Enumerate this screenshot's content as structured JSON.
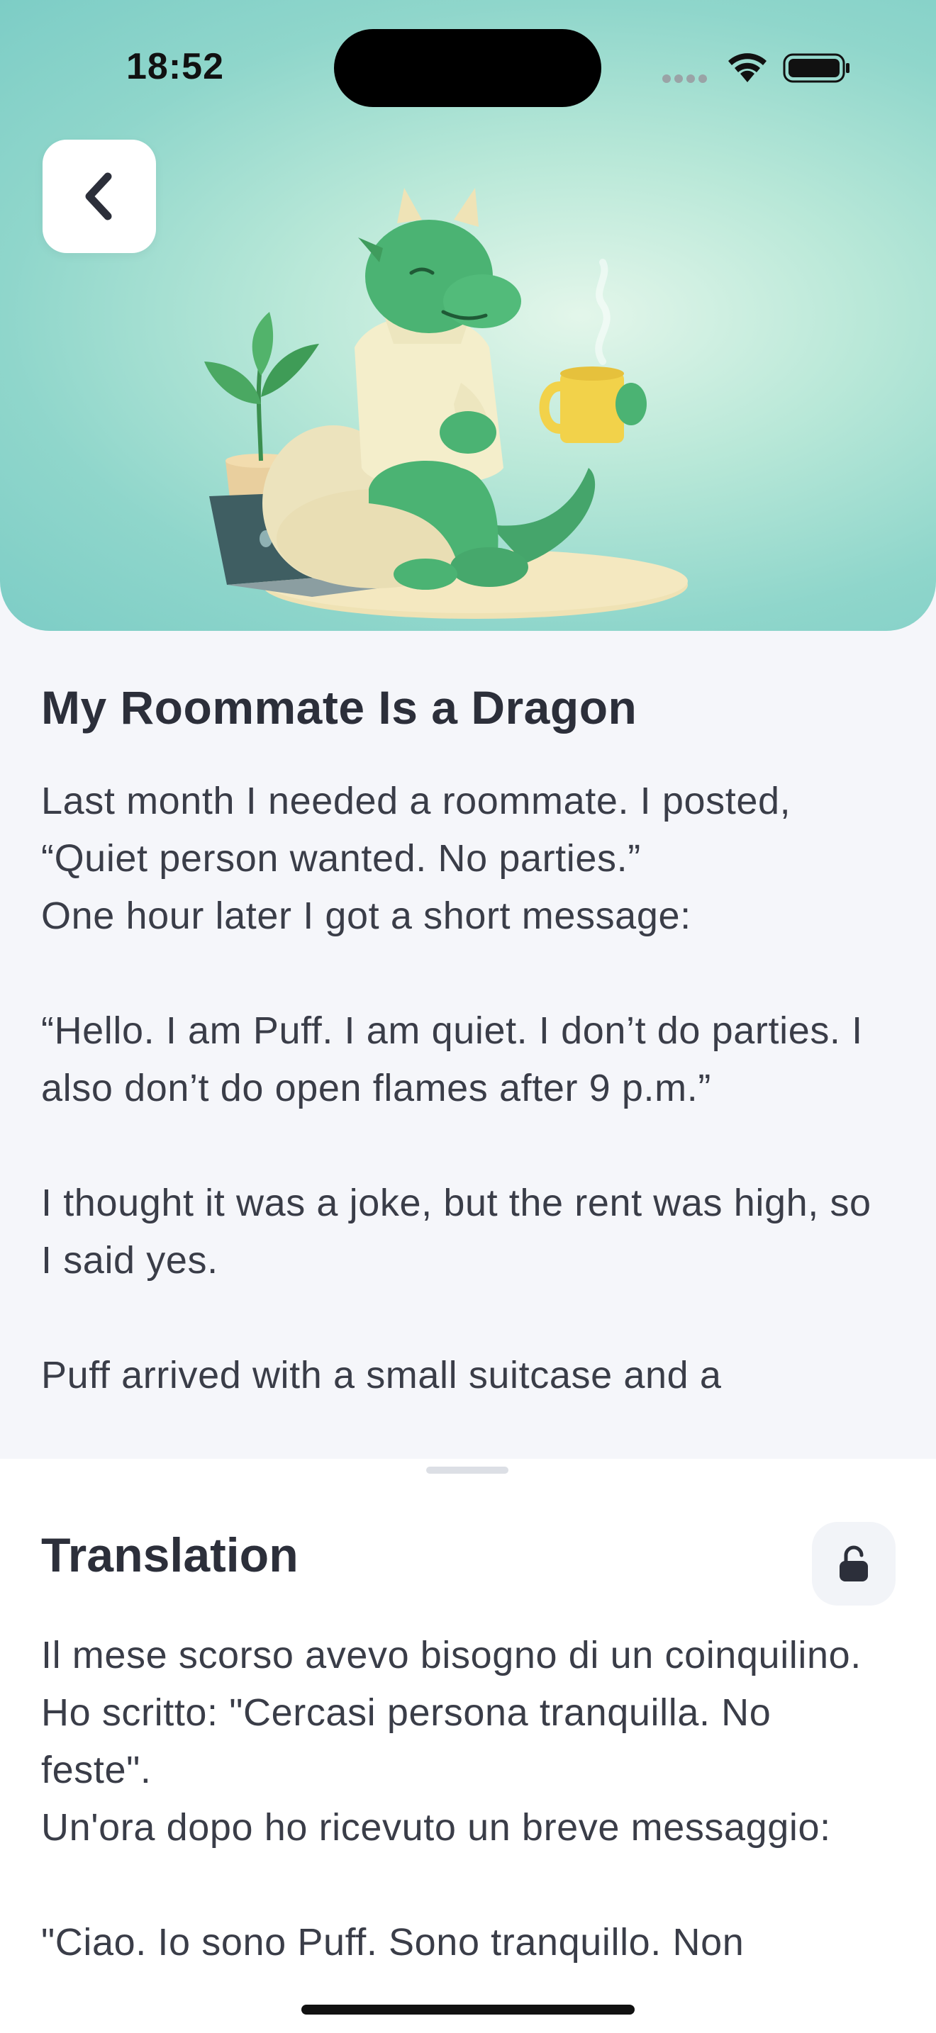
{
  "status_bar": {
    "time": "18:52",
    "icons": [
      "cellular-dots-icon",
      "wifi-icon",
      "battery-icon"
    ]
  },
  "header": {
    "back_icon": "chevron-left-icon",
    "illustration": "dragon-with-coffee-illustration"
  },
  "story": {
    "title": "My Roommate Is a Dragon",
    "paragraphs": [
      "Last month I needed a roommate. I posted, “Quiet person wanted. No parties.”",
      "One hour later I got a short message:",
      "“Hello. I am Puff. I am quiet. I don’t do parties. I also don’t do open flames after 9 p.m.”",
      "I thought it was a joke, but the rent was high, so I said yes.",
      "Puff arrived with a small suitcase and a"
    ]
  },
  "translation": {
    "title": "Translation",
    "lock_icon": "lock-open-icon",
    "paragraphs": [
      "Il mese scorso avevo bisogno di un coinquilino. Ho scritto: \"Cercasi persona tranquilla. No feste\".",
      "Un'ora dopo ho ricevuto un breve messaggio:",
      "\"Ciao. Io sono Puff. Sono tranquillo. Non"
    ]
  },
  "colors": {
    "hero_gradient_center": "#e3f6ea",
    "hero_gradient_edge": "#7dcdc6",
    "page_background": "#f5f6fa",
    "sheet_background": "#ffffff",
    "text_primary": "#2c2f3a"
  }
}
